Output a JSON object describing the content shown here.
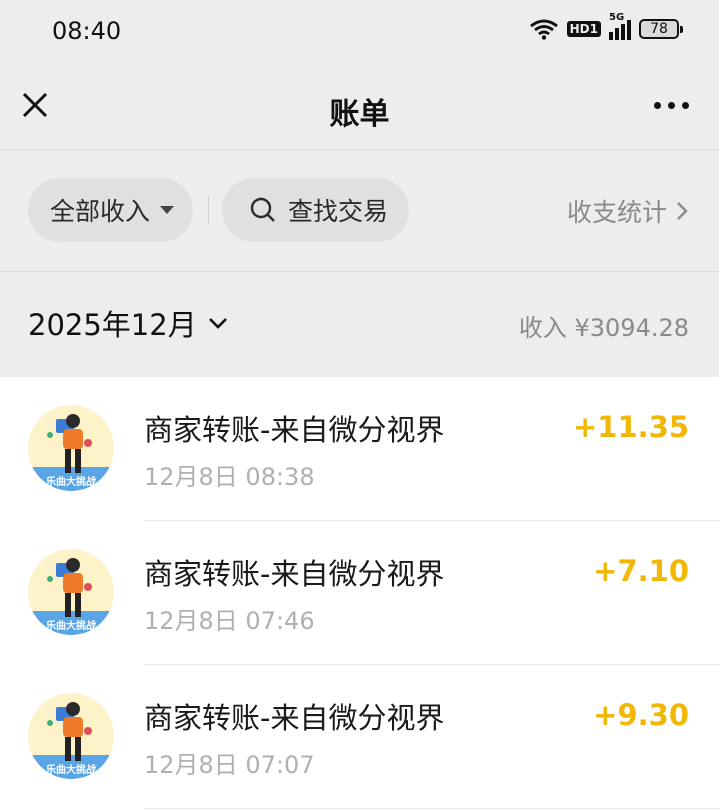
{
  "status_bar": {
    "time": "08:40",
    "hd_label": "HD1",
    "network_label": "5G",
    "battery": "78"
  },
  "nav": {
    "title": "账单",
    "close_icon": "close-icon",
    "more_icon": "more-icon"
  },
  "filters": {
    "income_filter_label": "全部收入",
    "search_label": "查找交易",
    "stats_label": "收支统计"
  },
  "month_bar": {
    "month_label": "2025年12月",
    "summary_label": "收入",
    "summary_amount": "¥3094.28"
  },
  "transactions": [
    {
      "title": "商家转账-来自微分视界",
      "date": "12月8日 08:38",
      "amount": "+11.35",
      "avatar_text": "乐曲大挑战"
    },
    {
      "title": "商家转账-来自微分视界",
      "date": "12月8日 07:46",
      "amount": "+7.10",
      "avatar_text": "乐曲大挑战"
    },
    {
      "title": "商家转账-来自微分视界",
      "date": "12月8日 07:07",
      "amount": "+9.30",
      "avatar_text": "乐曲大挑战"
    }
  ],
  "colors": {
    "background": "#ededed",
    "list_background": "#ffffff",
    "amount": "#f2b705",
    "secondary_text": "#8a8a8a"
  }
}
